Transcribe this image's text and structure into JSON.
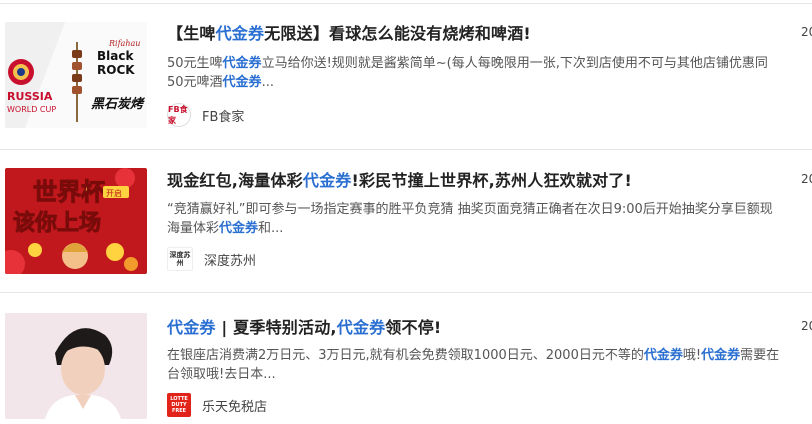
{
  "articles": [
    {
      "title_parts": [
        "【生啤",
        "代金券",
        "无限送】看球怎么能没有烧烤和啤酒!"
      ],
      "date": "20",
      "excerpt_lines": [
        [
          "50元生啤",
          "代金券",
          "立马给你送!规则就是酱紫简单~(每人每晚限用一张,下次到店使用不可与其他店铺优惠同"
        ],
        [
          "50元啤酒",
          "代金券",
          "..."
        ]
      ],
      "source": "FB食家",
      "source_logo_text": "FB食家",
      "thumb_texts": {
        "brand_top": "Rifahau",
        "brand_1": "Black",
        "brand_2": "ROCK",
        "brand_cn": "黑石炭烤",
        "cup_1": "RUSSIA",
        "cup_2": "WORLD CUP"
      }
    },
    {
      "title_parts": [
        "现金红包,海量体彩",
        "代金券",
        "!彩民节撞上世界杯,苏州人狂欢就对了!"
      ],
      "date": "20",
      "excerpt_lines": [
        [
          "“竞猜赢好礼”即可参与一场指定赛事的胜平负竞猜 抽奖页面竞猜正确者在次日9:00后开始抽奖分享巨额现",
          "",
          ""
        ],
        [
          "海量体彩",
          "代金券",
          "和..."
        ]
      ],
      "source": "深度苏州",
      "source_logo_text": "深度苏州",
      "thumb_texts": {
        "line1": "世界杯",
        "line2": "该你上场",
        "tag": "开启"
      }
    },
    {
      "title_parts": [
        "代金券",
        " | 夏季特别活动,",
        "代金券",
        "领不停!"
      ],
      "date": "20",
      "excerpt_lines": [
        [
          "在银座店消费满2万日元、3万日元,就有机会免费领取1000日元、2000日元不等的",
          "代金券",
          "哦!",
          "代金券",
          "需要在"
        ],
        [
          "台领取哦!去日本...",
          "",
          ""
        ]
      ],
      "source": "乐天免税店",
      "source_logo_text": "LOTTE DUTY FREE"
    }
  ],
  "colors": {
    "highlight": "#2a6fd1",
    "separator": "#e6e6e6"
  }
}
